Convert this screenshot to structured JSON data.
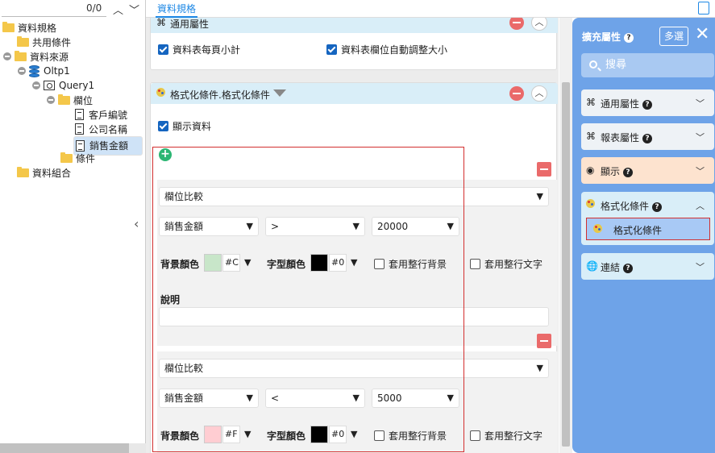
{
  "tree": {
    "counter": "0/0",
    "nodes": [
      {
        "label": "資料規格"
      },
      {
        "label": "共用條件"
      },
      {
        "label": "資料來源"
      },
      {
        "label": "Oltp1"
      },
      {
        "label": "Query1"
      },
      {
        "label": "欄位"
      },
      {
        "label": "客戶編號"
      },
      {
        "label": "公司名稱"
      },
      {
        "label": "銷售金額"
      },
      {
        "label": "條件"
      },
      {
        "label": "資料組合"
      }
    ]
  },
  "tabs": {
    "active": "資料規格"
  },
  "general": {
    "title": "通用屬性",
    "subtotal_label": "資料表每頁小計",
    "autosize_label": "資料表欄位自動調整大小"
  },
  "format": {
    "title": "格式化條件.格式化條件",
    "show_data_label": "顯示資料",
    "rules": [
      {
        "type": "欄位比較",
        "field": "銷售金額",
        "operator": ">",
        "value": "20000",
        "bg_label": "背景顏色",
        "bg_color": "#c8e6c9",
        "bg_hex": "#C",
        "fg_label": "字型顏色",
        "fg_color": "#000000",
        "fg_hex": "#0",
        "row_bg_label": "套用整行背景",
        "row_text_label": "套用整行文字",
        "desc_label": "說明"
      },
      {
        "type": "欄位比較",
        "field": "銷售金額",
        "operator": "<",
        "value": "5000",
        "bg_label": "背景顏色",
        "bg_color": "#ffcdd2",
        "bg_hex": "#F",
        "fg_label": "字型顏色",
        "fg_color": "#000000",
        "fg_hex": "#0",
        "row_bg_label": "套用整行背景",
        "row_text_label": "套用整行文字"
      }
    ]
  },
  "panel": {
    "title": "擴充屬性",
    "multi_label": "多選",
    "search_placeholder": "搜尋",
    "sections": [
      {
        "label": "通用屬性",
        "icon": "command-icon",
        "color": "#eef2f6"
      },
      {
        "label": "報表屬性",
        "icon": "command-icon",
        "color": "#eef2f6"
      },
      {
        "label": "顯示",
        "icon": "eye-icon",
        "color": "#fde3cf"
      },
      {
        "label": "格式化條件",
        "icon": "format-icon",
        "color": "#d9eef8"
      },
      {
        "label": "連結",
        "icon": "link-icon",
        "color": "#d9eef8"
      }
    ],
    "sub_item": "格式化條件"
  }
}
